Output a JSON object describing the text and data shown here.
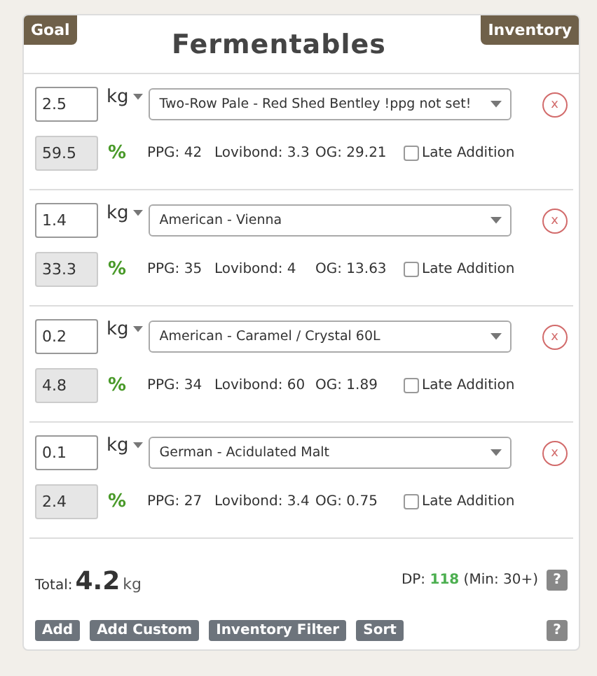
{
  "header": {
    "goal_tab": "Goal",
    "title": "Fermentables",
    "inventory_tab": "Inventory"
  },
  "rows": [
    {
      "amount": "2.5",
      "unit": "kg",
      "fermentable": "Two-Row Pale - Red Shed Bentley !ppg not set!",
      "remove": "x",
      "percent": "59.5",
      "percent_sign": "%",
      "ppg": "PPG: 42",
      "lovibond": "Lovibond: 3.3",
      "og": "OG: 29.21",
      "late_addition_label": "Late Addition",
      "late_addition": false
    },
    {
      "amount": "1.4",
      "unit": "kg",
      "fermentable": "American - Vienna",
      "remove": "x",
      "percent": "33.3",
      "percent_sign": "%",
      "ppg": "PPG: 35",
      "lovibond": "Lovibond: 4",
      "og": "OG: 13.63",
      "late_addition_label": "Late Addition",
      "late_addition": false
    },
    {
      "amount": "0.2",
      "unit": "kg",
      "fermentable": "American - Caramel / Crystal 60L",
      "remove": "x",
      "percent": "4.8",
      "percent_sign": "%",
      "ppg": "PPG: 34",
      "lovibond": "Lovibond: 60",
      "og": "OG: 1.89",
      "late_addition_label": "Late Addition",
      "late_addition": false
    },
    {
      "amount": "0.1",
      "unit": "kg",
      "fermentable": "German - Acidulated Malt",
      "remove": "x",
      "percent": "2.4",
      "percent_sign": "%",
      "ppg": "PPG: 27",
      "lovibond": "Lovibond: 3.4",
      "og": "OG: 0.75",
      "late_addition_label": "Late Addition",
      "late_addition": false
    }
  ],
  "total": {
    "label": "Total:",
    "value": "4.2",
    "unit": "kg"
  },
  "dp": {
    "label": "DP:",
    "value": "118",
    "min": "(Min: 30+)",
    "help": "?"
  },
  "buttons": [
    "Add",
    "Add Custom",
    "Inventory Filter",
    "Sort"
  ],
  "help": "?"
}
